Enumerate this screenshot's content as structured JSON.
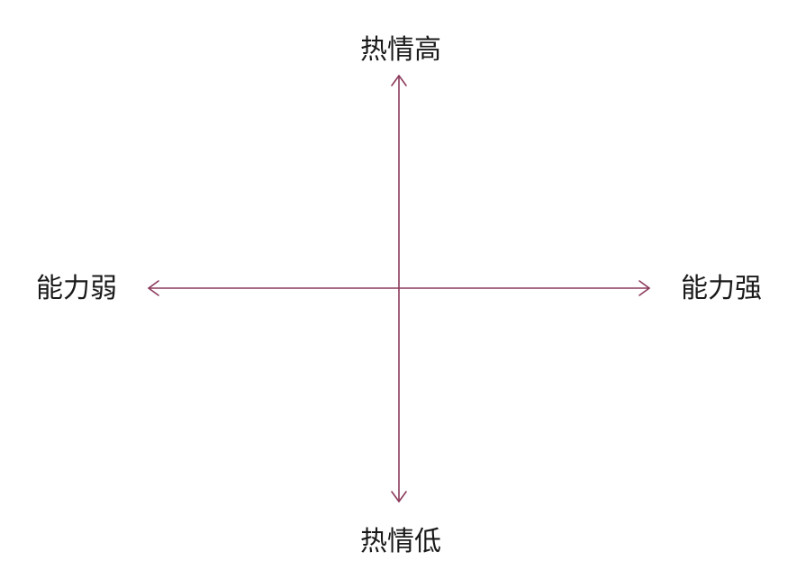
{
  "axes": {
    "top_label": "热情高",
    "bottom_label": "热情低",
    "left_label": "能力弱",
    "right_label": "能力强"
  },
  "colors": {
    "axis": "#8b3a5b",
    "text": "#1a1a1a",
    "background": "#ffffff"
  }
}
